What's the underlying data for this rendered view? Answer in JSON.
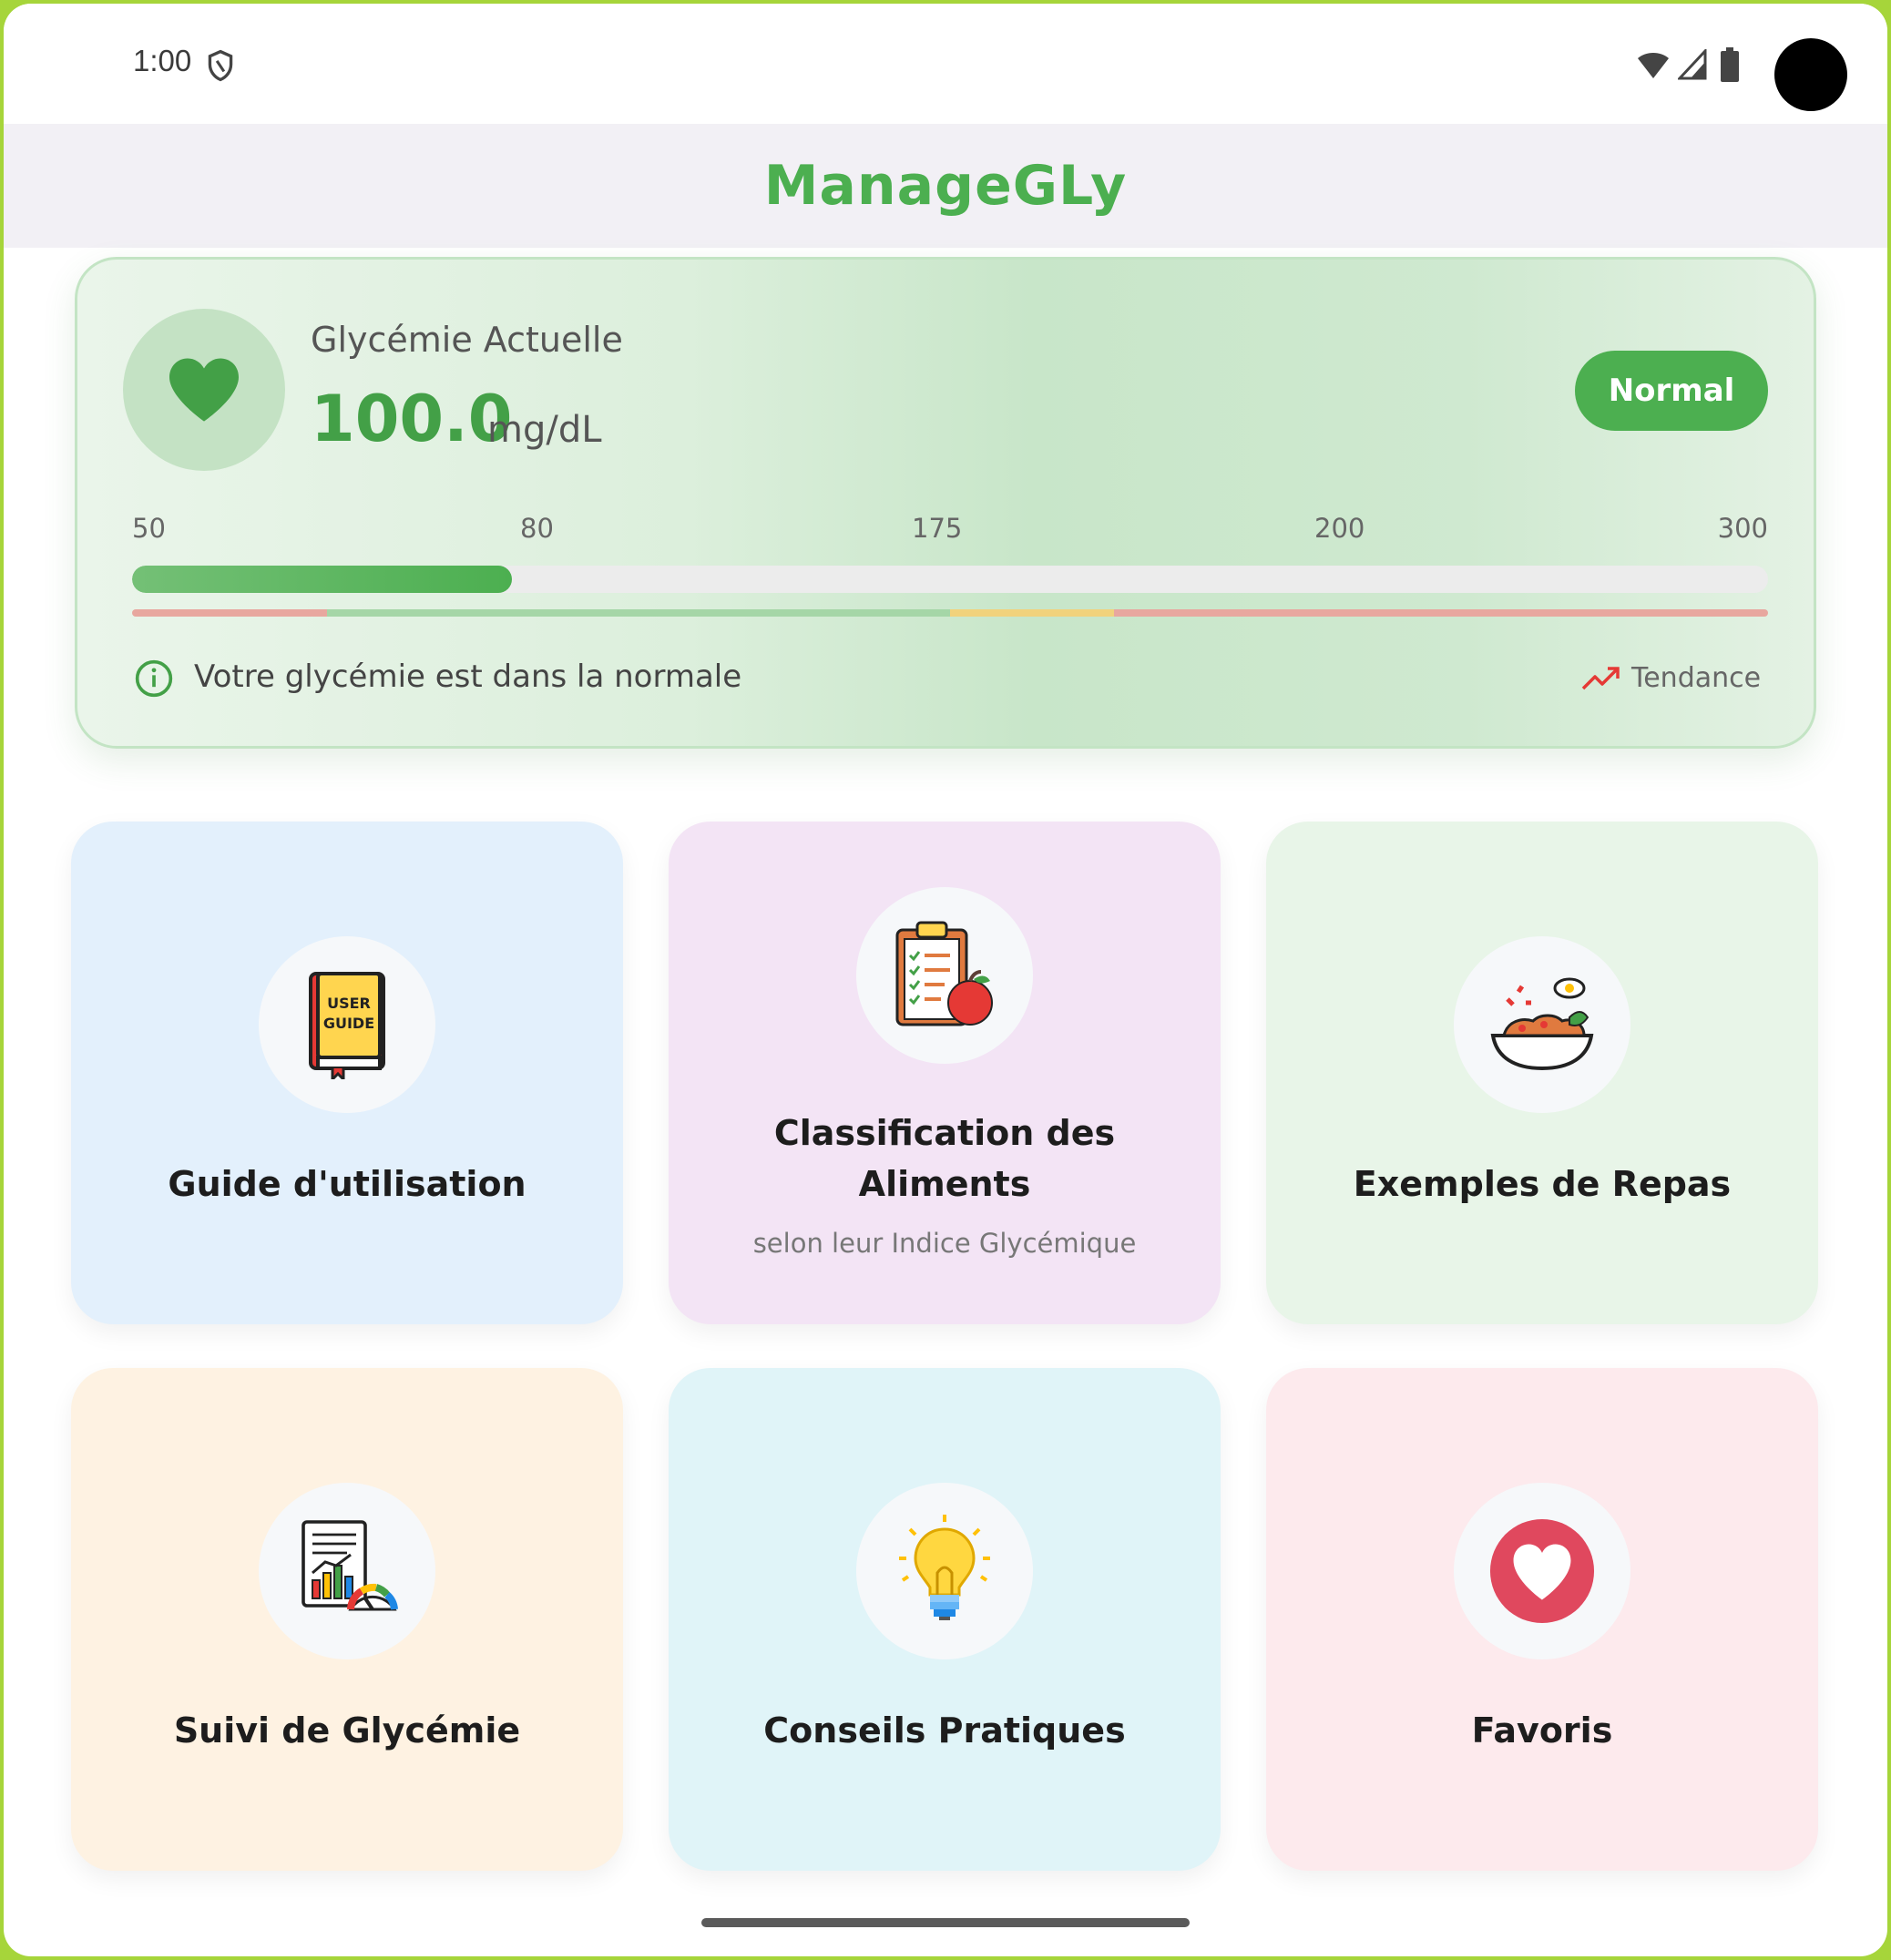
{
  "status_bar": {
    "time": "1:00",
    "icons": [
      "shield-icon",
      "wifi-icon",
      "signal-icon",
      "battery-icon"
    ]
  },
  "app_bar": {
    "title": "ManageGLy"
  },
  "glucose_card": {
    "label": "Glycémie Actuelle",
    "value": "100.0",
    "unit": "mg/dL",
    "status": "Normal",
    "scale_labels": [
      "50",
      "80",
      "175",
      "200",
      "300"
    ],
    "progress_fraction": 0.232,
    "info_text": "Votre glycémie est dans la normale",
    "trend_label": "Tendance",
    "colors": {
      "accent": "#4caf50",
      "low": "#e8a79f",
      "normal": "#a5d6a7",
      "elevated": "#f1d27c",
      "high": "#e8a79f",
      "trend": "#e53935"
    }
  },
  "tiles": [
    {
      "title": "Guide d'utilisation",
      "subtitle": "",
      "icon": "user-guide-book-icon",
      "bg": "#e3f0fc"
    },
    {
      "title": "Classification des Aliments",
      "subtitle": "selon leur Indice Glycémique",
      "icon": "clipboard-apple-icon",
      "bg": "#f3e4f5"
    },
    {
      "title": "Exemples de Repas",
      "subtitle": "",
      "icon": "meal-bowl-icon",
      "bg": "#e8f5e8"
    },
    {
      "title": "Suivi de Glycémie",
      "subtitle": "",
      "icon": "report-chart-icon",
      "bg": "#fef2e2"
    },
    {
      "title": "Conseils Pratiques",
      "subtitle": "",
      "icon": "lightbulb-icon",
      "bg": "#e0f4f8"
    },
    {
      "title": "Favoris",
      "subtitle": "",
      "icon": "heart-favorite-icon",
      "bg": "#fdeaed"
    }
  ]
}
